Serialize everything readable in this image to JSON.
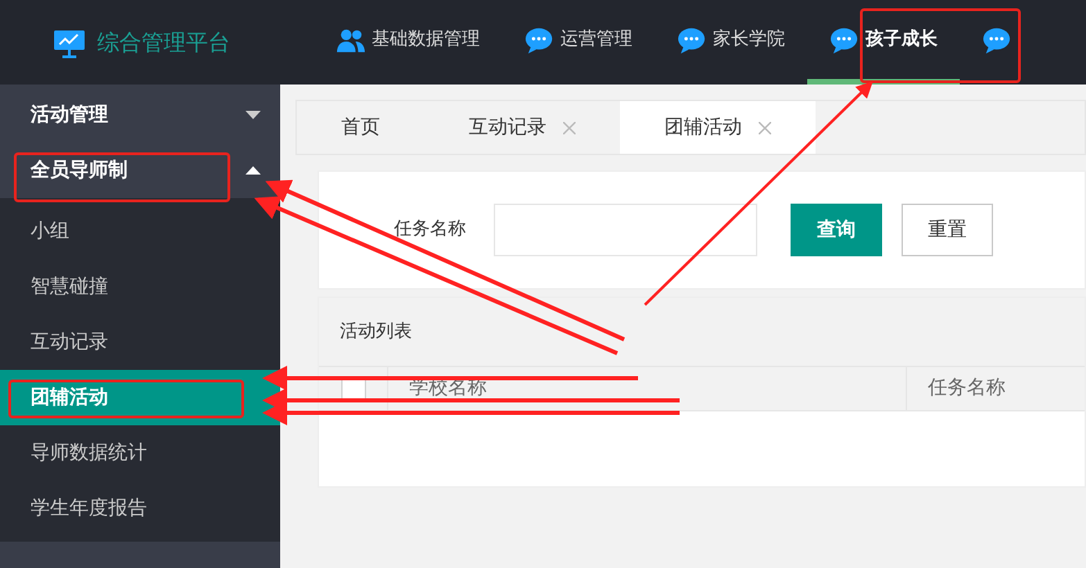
{
  "logo": {
    "title": "综合管理平台"
  },
  "nav": [
    {
      "label": "基础数据管理",
      "kind": "people",
      "selected": false
    },
    {
      "label": "运营管理",
      "kind": "chat",
      "selected": false
    },
    {
      "label": "家长学院",
      "kind": "chat",
      "selected": false
    },
    {
      "label": "孩子成长",
      "kind": "chat",
      "selected": true
    },
    {
      "kind": "chat",
      "selected": false
    }
  ],
  "sidebar": {
    "items": [
      {
        "label": "活动管理",
        "expanded": false
      },
      {
        "label": "全员导师制",
        "expanded": true,
        "children": [
          {
            "label": "小组",
            "selected": false
          },
          {
            "label": "智慧碰撞",
            "selected": false
          },
          {
            "label": "互动记录",
            "selected": false
          },
          {
            "label": "团辅活动",
            "selected": true
          },
          {
            "label": "导师数据统计",
            "selected": false
          },
          {
            "label": "学生年度报告",
            "selected": false
          }
        ]
      }
    ]
  },
  "tabs": [
    {
      "label": "首页",
      "closable": false,
      "selected": false
    },
    {
      "label": "互动记录",
      "closable": true,
      "selected": false
    },
    {
      "label": "团辅活动",
      "closable": true,
      "selected": true
    }
  ],
  "search": {
    "label": "任务名称",
    "buttons": [
      {
        "label": "查询",
        "kind": "primary"
      },
      {
        "label": "重置",
        "kind": "plain"
      }
    ]
  },
  "table": {
    "title": "活动列表",
    "select_all": {
      "checked": false
    },
    "columns": [
      "学校名称",
      "任务名称"
    ]
  }
}
